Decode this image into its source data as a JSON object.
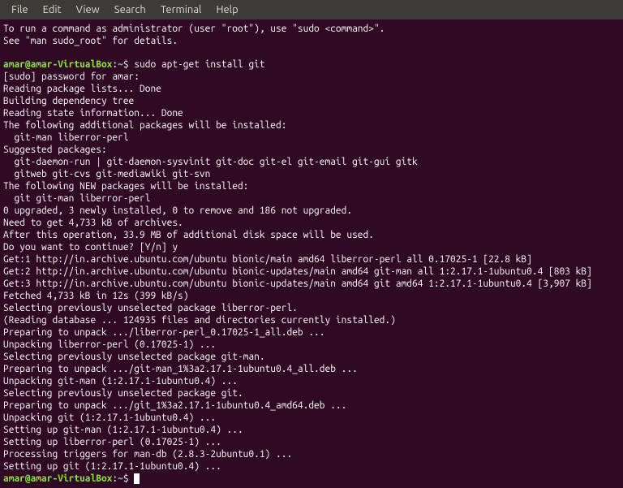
{
  "menubar": {
    "items": [
      "File",
      "Edit",
      "View",
      "Search",
      "Terminal",
      "Help"
    ]
  },
  "prompt": {
    "user_host": "amar@amar-VirtualBox",
    "colon": ":",
    "path": "~",
    "dollar": "$ "
  },
  "command1": "sudo apt-get install git",
  "output": [
    "To run a command as administrator (user \"root\"), use \"sudo <command>\".",
    "See \"man sudo_root\" for details.",
    "",
    "__PROMPT1__",
    "[sudo] password for amar:",
    "Reading package lists... Done",
    "Building dependency tree",
    "Reading state information... Done",
    "The following additional packages will be installed:",
    "  git-man liberror-perl",
    "Suggested packages:",
    "  git-daemon-run | git-daemon-sysvinit git-doc git-el git-email git-gui gitk",
    "  gitweb git-cvs git-mediawiki git-svn",
    "The following NEW packages will be installed:",
    "  git git-man liberror-perl",
    "0 upgraded, 3 newly installed, 0 to remove and 186 not upgraded.",
    "Need to get 4,733 kB of archives.",
    "After this operation, 33.9 MB of additional disk space will be used.",
    "Do you want to continue? [Y/n] y",
    "Get:1 http://in.archive.ubuntu.com/ubuntu bionic/main amd64 liberror-perl all 0.17025-1 [22.8 kB]",
    "Get:2 http://in.archive.ubuntu.com/ubuntu bionic-updates/main amd64 git-man all 1:2.17.1-1ubuntu0.4 [803 kB]",
    "Get:3 http://in.archive.ubuntu.com/ubuntu bionic-updates/main amd64 git amd64 1:2.17.1-1ubuntu0.4 [3,907 kB]",
    "Fetched 4,733 kB in 12s (399 kB/s)",
    "Selecting previously unselected package liberror-perl.",
    "(Reading database ... 124935 files and directories currently installed.)",
    "Preparing to unpack .../liberror-perl_0.17025-1_all.deb ...",
    "Unpacking liberror-perl (0.17025-1) ...",
    "Selecting previously unselected package git-man.",
    "Preparing to unpack .../git-man_1%3a2.17.1-1ubuntu0.4_all.deb ...",
    "Unpacking git-man (1:2.17.1-1ubuntu0.4) ...",
    "Selecting previously unselected package git.",
    "Preparing to unpack .../git_1%3a2.17.1-1ubuntu0.4_amd64.deb ...",
    "Unpacking git (1:2.17.1-1ubuntu0.4) ...",
    "Setting up git-man (1:2.17.1-1ubuntu0.4) ...",
    "Setting up liberror-perl (0.17025-1) ...",
    "Processing triggers for man-db (2.8.3-2ubuntu0.1) ...",
    "Setting up git (1:2.17.1-1ubuntu0.4) ...",
    "__PROMPT2__"
  ]
}
